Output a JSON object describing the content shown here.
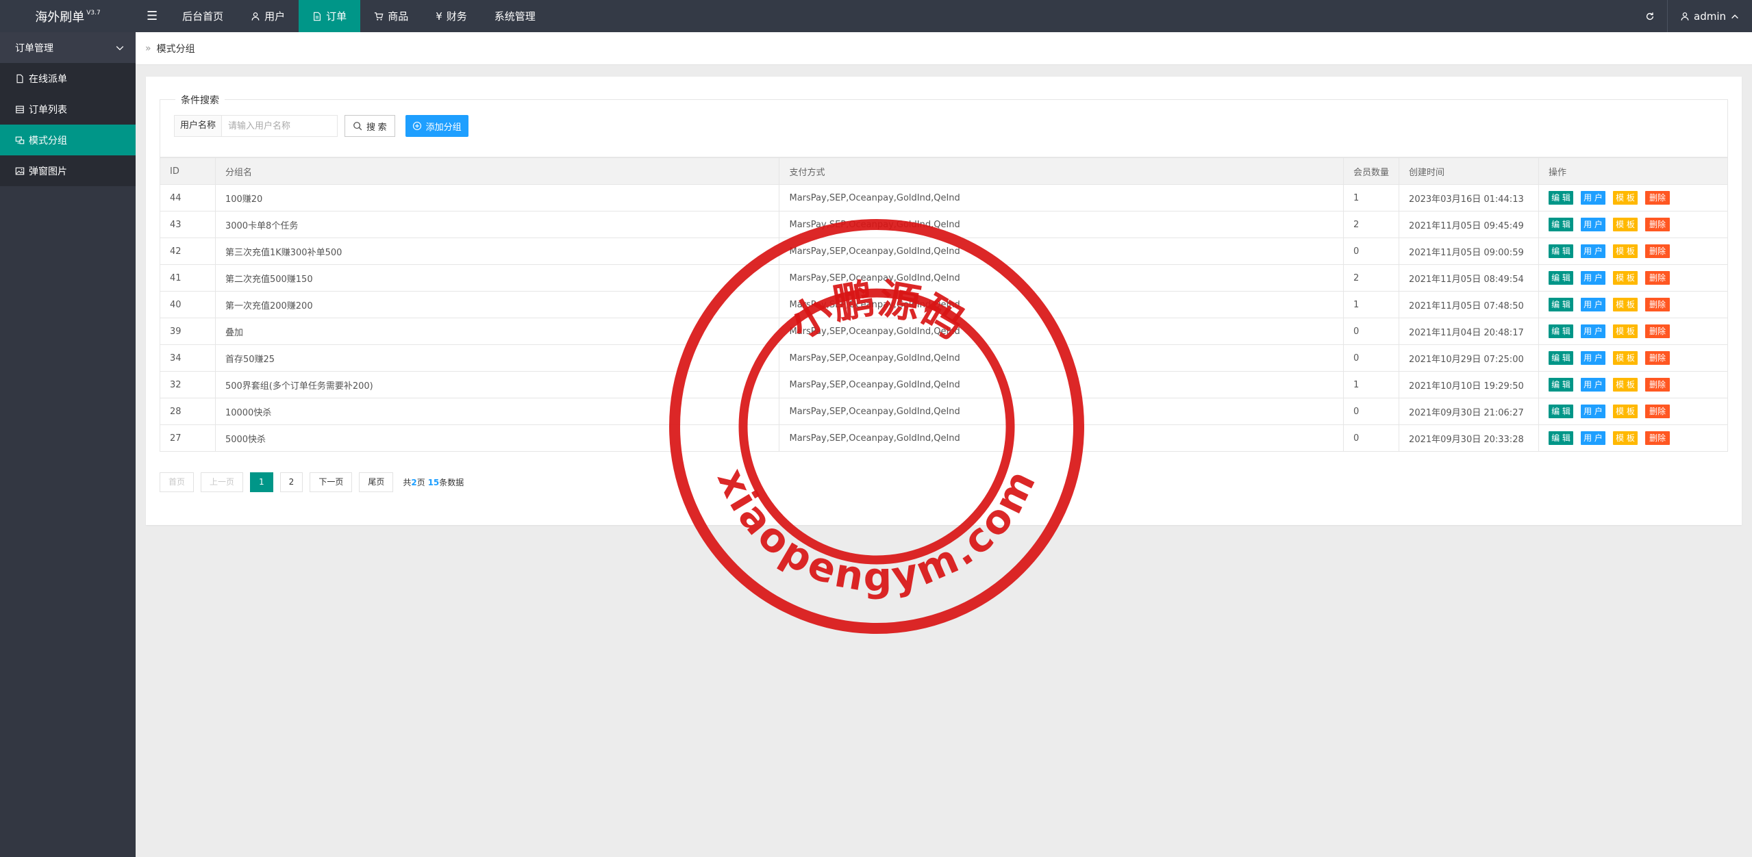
{
  "app": {
    "title": "海外刷单",
    "version": "V3.7"
  },
  "topnav": {
    "items": [
      {
        "label": "后台首页",
        "icon": ""
      },
      {
        "label": "用户",
        "icon": "user-icon"
      },
      {
        "label": "订单",
        "icon": "document-icon",
        "active": true
      },
      {
        "label": "商品",
        "icon": "cart-icon"
      },
      {
        "label": "财务",
        "icon": "yen-icon"
      },
      {
        "label": "系统管理",
        "icon": ""
      }
    ],
    "refresh_icon": "refresh-icon",
    "user": "admin"
  },
  "sidebar": {
    "group": "订单管理",
    "items": [
      {
        "label": "在线派单",
        "icon": "document-icon"
      },
      {
        "label": "订单列表",
        "icon": "list-icon"
      },
      {
        "label": "模式分组",
        "icon": "group-icon",
        "active": true
      },
      {
        "label": "弹窗图片",
        "icon": "image-icon"
      }
    ]
  },
  "breadcrumb": {
    "current": "模式分组"
  },
  "search": {
    "legend": "条件搜索",
    "label": "用户名称",
    "placeholder": "请输入用户名称",
    "search_button": "搜 索",
    "add_button": "添加分组"
  },
  "table": {
    "headers": [
      "ID",
      "分组名",
      "支付方式",
      "会员数量",
      "创建时间",
      "操作"
    ],
    "actions": {
      "edit": "编 辑",
      "user": "用 户",
      "template": "模 板",
      "delete": "删除"
    },
    "rows": [
      {
        "id": "44",
        "name": "100赚20",
        "payment": "MarsPay,SEP,Oceanpay,GoldInd,QeInd",
        "count": "1",
        "created": "2023年03月16日 01:44:13"
      },
      {
        "id": "43",
        "name": "3000卡单8个任务",
        "payment": "MarsPay,SEP,Oceanpay,GoldInd,QeInd",
        "count": "2",
        "created": "2021年11月05日 09:45:49"
      },
      {
        "id": "42",
        "name": "第三次充值1K赚300补单500",
        "payment": "MarsPay,SEP,Oceanpay,GoldInd,QeInd",
        "count": "0",
        "created": "2021年11月05日 09:00:59"
      },
      {
        "id": "41",
        "name": "第二次充值500赚150",
        "payment": "MarsPay,SEP,Oceanpay,GoldInd,QeInd",
        "count": "2",
        "created": "2021年11月05日 08:49:54"
      },
      {
        "id": "40",
        "name": "第一次充值200赚200",
        "payment": "MarsPay,SEP,Oceanpay,GoldInd,QeInd",
        "count": "1",
        "created": "2021年11月05日 07:48:50"
      },
      {
        "id": "39",
        "name": "叠加",
        "payment": "MarsPay,SEP,Oceanpay,GoldInd,QeInd",
        "count": "0",
        "created": "2021年11月04日 20:48:17"
      },
      {
        "id": "34",
        "name": "首存50赚25",
        "payment": "MarsPay,SEP,Oceanpay,GoldInd,QeInd",
        "count": "0",
        "created": "2021年10月29日 07:25:00"
      },
      {
        "id": "32",
        "name": "500界套组(多个订单任务需要补200)",
        "payment": "MarsPay,SEP,Oceanpay,GoldInd,QeInd",
        "count": "1",
        "created": "2021年10月10日 19:29:50"
      },
      {
        "id": "28",
        "name": "10000快杀",
        "payment": "MarsPay,SEP,Oceanpay,GoldInd,QeInd",
        "count": "0",
        "created": "2021年09月30日 21:06:27"
      },
      {
        "id": "27",
        "name": "5000快杀",
        "payment": "MarsPay,SEP,Oceanpay,GoldInd,QeInd",
        "count": "0",
        "created": "2021年09月30日 20:33:28"
      }
    ]
  },
  "pagination": {
    "first": "首页",
    "prev": "上一页",
    "pages": [
      "1",
      "2"
    ],
    "current": "1",
    "next": "下一页",
    "last": "尾页",
    "total_prefix": "共",
    "total_pages": "2",
    "pages_suffix": "页",
    "total_records": "15",
    "records_suffix": "条数据"
  },
  "watermark": {
    "text_cn": "小鹏源码",
    "text_en": "xiaopengym.com",
    "color": "#d91515"
  },
  "colors": {
    "header_bg": "#343a46",
    "sidebar_bg": "#333742",
    "accent": "#009688",
    "blue": "#1e9fff",
    "yellow": "#ffb800",
    "red": "#ff5722"
  }
}
